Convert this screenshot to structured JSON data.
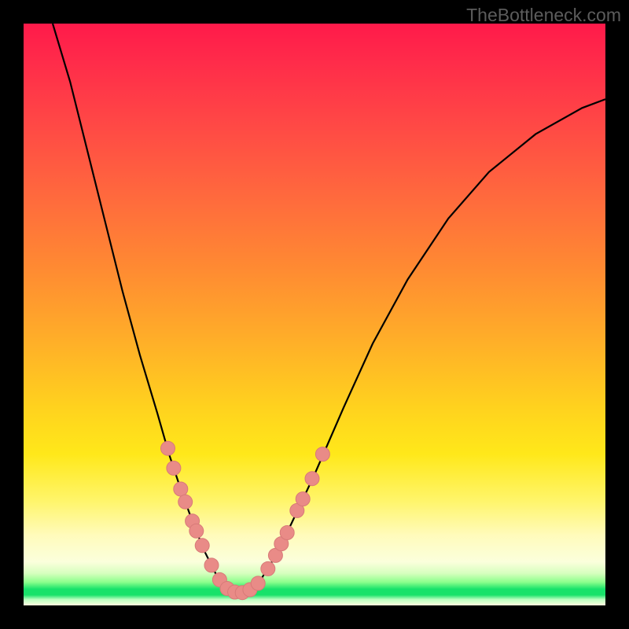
{
  "watermark": "TheBottleneck.com",
  "colors": {
    "curve_stroke": "#000000",
    "dot_fill": "#e98b87",
    "dot_stroke": "#d87a78",
    "background_frame": "#000000"
  },
  "chart_data": {
    "type": "line",
    "title": "",
    "xlabel": "",
    "ylabel": "",
    "xlim": [
      0,
      100
    ],
    "ylim": [
      0,
      100
    ],
    "grid": false,
    "legend": false,
    "notes": "Single V-shaped bottleneck curve with salmon dots near the minimum on both flanks. Axes unlabeled; no tick marks visible. Background is a vertical rainbow gradient (red→yellow→green). Values estimated from pixel positions.",
    "series": [
      {
        "name": "curve",
        "style": "line",
        "points": [
          {
            "x": 5.0,
            "y": 100.0
          },
          {
            "x": 8.0,
            "y": 90.0
          },
          {
            "x": 11.0,
            "y": 78.0
          },
          {
            "x": 14.0,
            "y": 66.0
          },
          {
            "x": 17.0,
            "y": 54.0
          },
          {
            "x": 20.0,
            "y": 43.0
          },
          {
            "x": 23.0,
            "y": 33.0
          },
          {
            "x": 25.0,
            "y": 26.0
          },
          {
            "x": 27.0,
            "y": 20.0
          },
          {
            "x": 29.0,
            "y": 14.5
          },
          {
            "x": 31.0,
            "y": 9.5
          },
          {
            "x": 33.0,
            "y": 5.5
          },
          {
            "x": 34.5,
            "y": 3.3
          },
          {
            "x": 36.0,
            "y": 2.4
          },
          {
            "x": 37.3,
            "y": 2.2
          },
          {
            "x": 38.6,
            "y": 2.5
          },
          {
            "x": 40.5,
            "y": 4.0
          },
          {
            "x": 43.0,
            "y": 8.0
          },
          {
            "x": 46.0,
            "y": 14.0
          },
          {
            "x": 50.0,
            "y": 22.5
          },
          {
            "x": 55.0,
            "y": 34.0
          },
          {
            "x": 60.0,
            "y": 45.0
          },
          {
            "x": 66.0,
            "y": 56.0
          },
          {
            "x": 73.0,
            "y": 66.5
          },
          {
            "x": 80.0,
            "y": 74.5
          },
          {
            "x": 88.0,
            "y": 81.0
          },
          {
            "x": 96.0,
            "y": 85.5
          },
          {
            "x": 100.0,
            "y": 87.0
          }
        ]
      },
      {
        "name": "dots",
        "style": "scatter",
        "points": [
          {
            "x": 24.8,
            "y": 27.0
          },
          {
            "x": 25.8,
            "y": 23.6
          },
          {
            "x": 27.0,
            "y": 20.0
          },
          {
            "x": 27.8,
            "y": 17.8
          },
          {
            "x": 29.0,
            "y": 14.5
          },
          {
            "x": 29.7,
            "y": 12.8
          },
          {
            "x": 30.7,
            "y": 10.3
          },
          {
            "x": 32.3,
            "y": 6.9
          },
          {
            "x": 33.7,
            "y": 4.4
          },
          {
            "x": 35.0,
            "y": 2.9
          },
          {
            "x": 36.3,
            "y": 2.3
          },
          {
            "x": 37.6,
            "y": 2.2
          },
          {
            "x": 38.9,
            "y": 2.7
          },
          {
            "x": 40.3,
            "y": 3.8
          },
          {
            "x": 42.0,
            "y": 6.3
          },
          {
            "x": 43.3,
            "y": 8.6
          },
          {
            "x": 44.3,
            "y": 10.6
          },
          {
            "x": 45.3,
            "y": 12.5
          },
          {
            "x": 47.0,
            "y": 16.3
          },
          {
            "x": 48.0,
            "y": 18.3
          },
          {
            "x": 49.6,
            "y": 21.8
          },
          {
            "x": 51.4,
            "y": 26.0
          }
        ]
      }
    ]
  }
}
